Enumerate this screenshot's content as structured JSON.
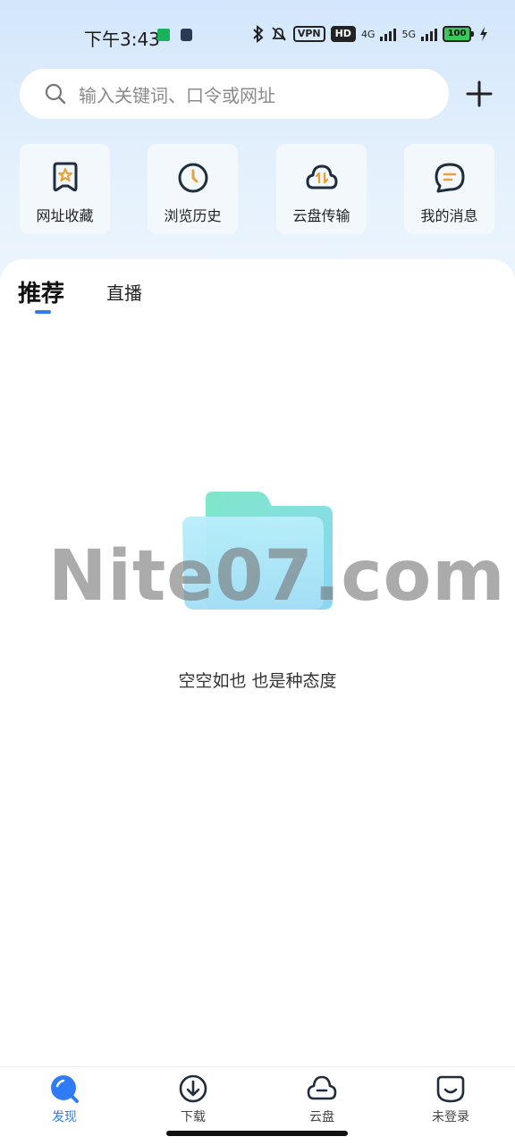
{
  "status_bar": {
    "time": "下午3:43",
    "vpn": "VPN",
    "hd": "HD",
    "net1": "4G",
    "net2": "5G",
    "battery": "100"
  },
  "search": {
    "placeholder": "输入关键词、口令或网址"
  },
  "quick_links": [
    {
      "label": "网址收藏",
      "icon": "bookmark-star-icon"
    },
    {
      "label": "浏览历史",
      "icon": "clock-icon"
    },
    {
      "label": "云盘传输",
      "icon": "cloud-transfer-icon"
    },
    {
      "label": "我的消息",
      "icon": "message-icon"
    }
  ],
  "tabs": [
    {
      "label": "推荐",
      "active": true
    },
    {
      "label": "直播",
      "active": false
    }
  ],
  "empty_state": {
    "message": "空空如也 也是种态度"
  },
  "watermark": "Nite07.com",
  "bottom_nav": [
    {
      "label": "发现",
      "icon": "discover-icon",
      "active": true
    },
    {
      "label": "下载",
      "icon": "download-icon",
      "active": false
    },
    {
      "label": "云盘",
      "icon": "cloud-drive-icon",
      "active": false
    },
    {
      "label": "未登录",
      "icon": "account-icon",
      "active": false
    }
  ],
  "colors": {
    "accent": "#2f7cf6",
    "icon_orange": "#e8a23a",
    "icon_dark": "#1f2d3d"
  }
}
